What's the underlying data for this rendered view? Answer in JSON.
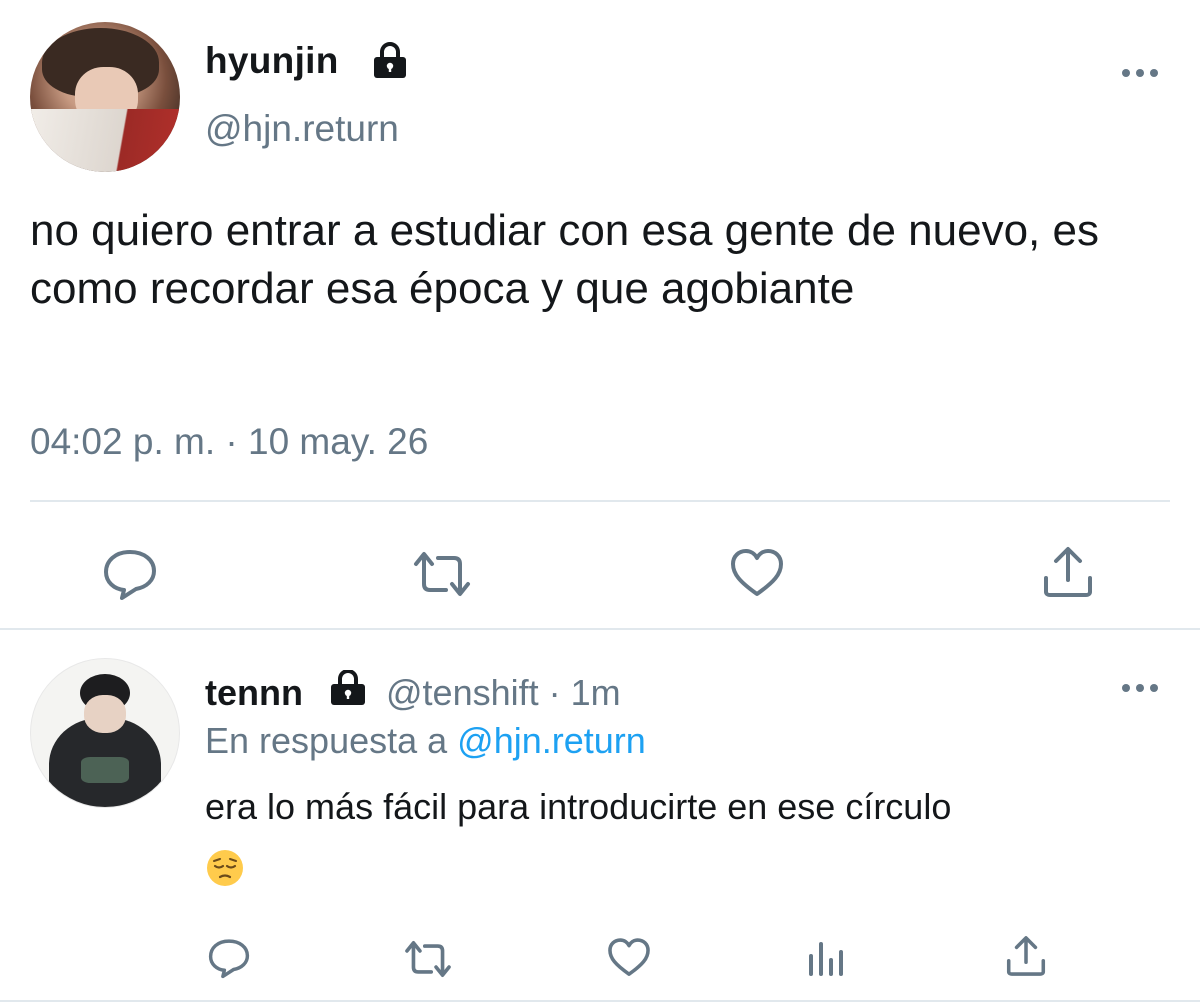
{
  "main_tweet": {
    "name": "hyunjin",
    "handle": "@hjn.return",
    "text": "no quiero entrar a estudiar con esa gente de nuevo, es como recordar esa época y que agobiante",
    "timestamp": "04:02 p. m. · 10 may. 26",
    "protected": true,
    "actions": [
      "reply-icon",
      "retweet-icon",
      "like-icon",
      "share-icon"
    ]
  },
  "reply_tweet": {
    "name": "tennn",
    "meta": "@tenshift · 1m",
    "reply_prefix": "En respuesta a",
    "reply_mention": "@hjn.return",
    "text": "era lo más fácil para introducirte en ese círculo",
    "emoji": "pensive-face",
    "protected": true,
    "actions": [
      "reply-icon",
      "retweet-icon",
      "like-icon",
      "analytics-icon",
      "share-icon"
    ]
  },
  "colors": {
    "text": "#14171a",
    "secondary": "#657786",
    "link": "#1da1f2",
    "divider": "#e1e8ed",
    "icon": "#657786"
  }
}
